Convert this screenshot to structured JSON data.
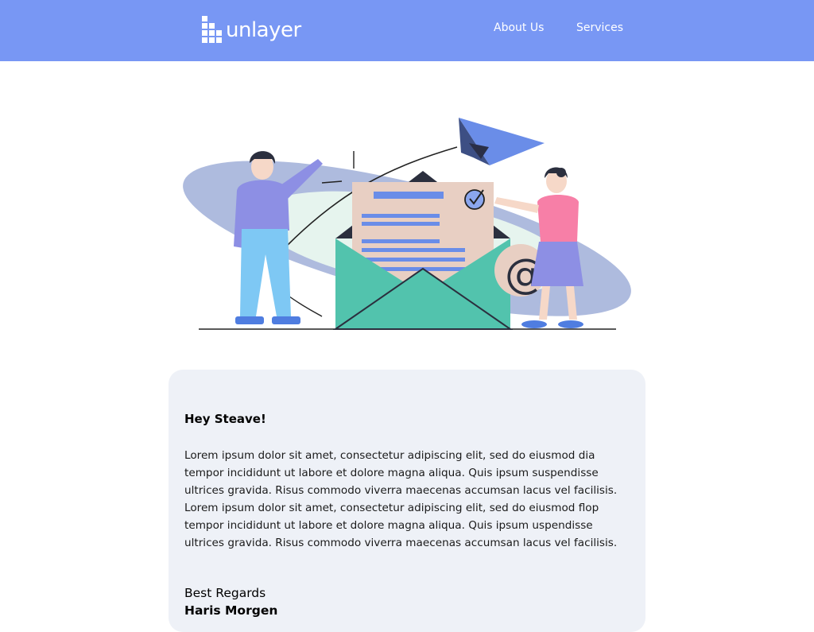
{
  "header": {
    "logo_text": "unlayer",
    "nav": [
      {
        "label": "About Us"
      },
      {
        "label": "Services"
      }
    ],
    "background_color": "#7897f4"
  },
  "illustration": {
    "icon": "email-envelope-illustration-icon",
    "envelope_symbol": "@"
  },
  "message": {
    "greeting": "Hey Steave!",
    "paragraph": "Lorem ipsum dolor sit amet, consectetur adipiscing elit, sed do eiusmod dia\ntempor incididunt ut labore et dolore magna aliqua. Quis ipsum suspendisse\nultrices gravida. Risus commodo viverra maecenas accumsan lacus vel facilisis.\nLorem ipsum dolor sit amet, consectetur adipiscing elit, sed do eiusmod flop\ntempor incididunt ut labore et dolore magna aliqua. Quis ipsum  uspendisse\nultrices gravida. Risus commodo viverra maecenas accumsan lacus vel facilisis.",
    "closing": "Best Regards",
    "signer": "Haris Morgen"
  },
  "colors": {
    "card_background": "#eef1f7",
    "accent": "#7897f4",
    "envelope_green": "#52c3ad",
    "letter_pink": "#e8cfc3"
  }
}
